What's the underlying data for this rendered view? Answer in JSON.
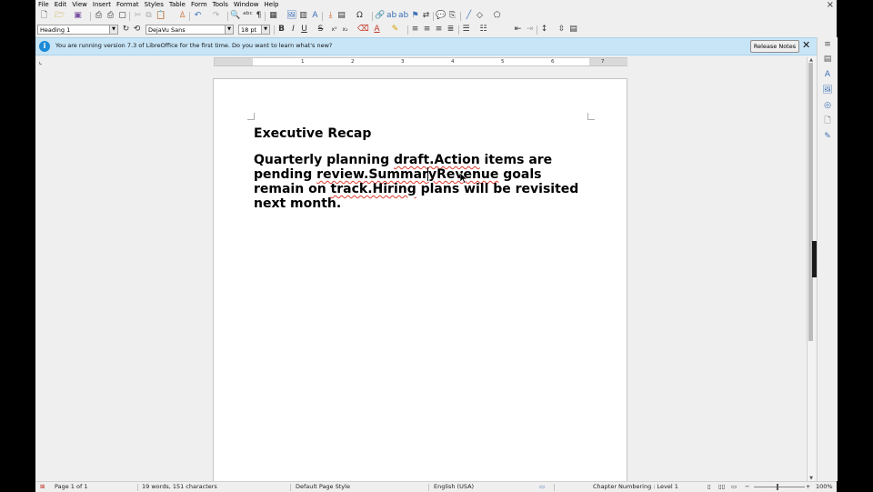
{
  "window": {
    "close_label": "×"
  },
  "menubar": {
    "items": [
      {
        "label": "File"
      },
      {
        "label": "Edit"
      },
      {
        "label": "View"
      },
      {
        "label": "Insert"
      },
      {
        "label": "Format"
      },
      {
        "label": "Styles"
      },
      {
        "label": "Table"
      },
      {
        "label": "Form"
      },
      {
        "label": "Tools"
      },
      {
        "label": "Window"
      },
      {
        "label": "Help"
      }
    ]
  },
  "formatting": {
    "paragraph_style": "Heading 1",
    "font_name": "DejaVu Sans",
    "font_size": "18 pt",
    "bold": "B",
    "italic": "I",
    "underline": "U",
    "strike": "S",
    "superscript": "x²",
    "subscript": "x₂"
  },
  "infobar": {
    "message": "You are running version 7.3 of LibreOffice for the first time. Do you want to learn what's new?",
    "button_label": "Release Notes",
    "close_label": "✕"
  },
  "ruler": {
    "numbers": [
      "1",
      "2",
      "3",
      "4",
      "5",
      "6",
      "7"
    ],
    "corner_glyph": "⌞"
  },
  "document": {
    "title": "Executive Recap",
    "paragraph": {
      "p1": "Quarterly planning ",
      "p2": "draft.Action",
      "p3": " items are pending ",
      "p4": "review.Summar",
      "p5": "yRevenue",
      "p6": " goals remain on ",
      "p7": "track.Hiring",
      "p8": " plans will be revisited next month."
    }
  },
  "statusbar": {
    "page": "Page 1 of 1",
    "words": "19 words, 151 characters",
    "page_style": "Default Page Style",
    "language": "English (USA)",
    "outline": "Chapter Numbering : Level 1",
    "zoom": "100%"
  }
}
